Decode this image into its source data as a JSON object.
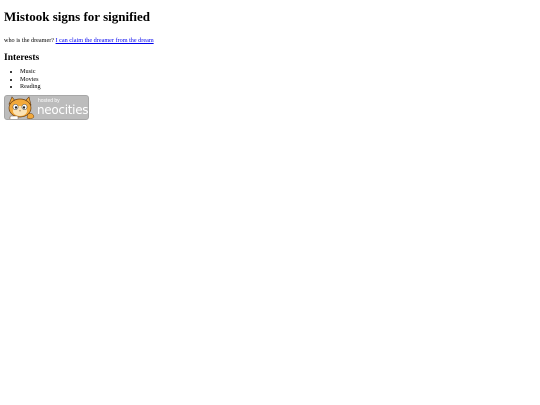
{
  "heading": "Mistook signs for signified",
  "intro": {
    "text": "who is the dreamer?",
    "link_text": "I can claim the dreamer from the dream"
  },
  "interests": {
    "heading": "Interests",
    "items": [
      "Music",
      "Movies",
      "Reading"
    ]
  },
  "badge": {
    "hosted_label": "hosted by",
    "brand_label": "neocities",
    "colors": {
      "background": "#bcbcbc",
      "cat_fur": "#f2a93b",
      "text": "#ffffff"
    }
  }
}
